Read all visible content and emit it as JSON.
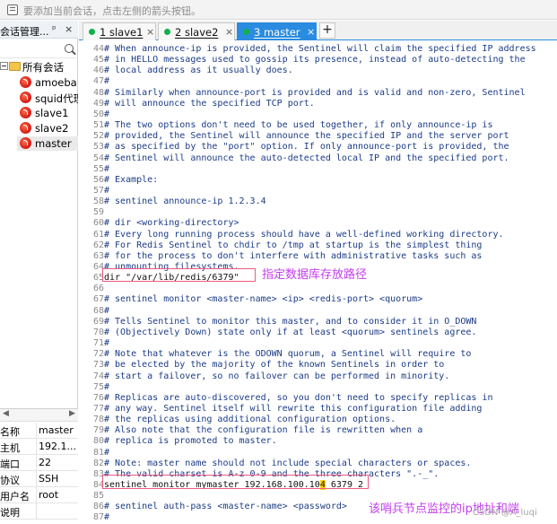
{
  "top_hint": {
    "icon": "session-list-icon",
    "text": "要添加当前会话，点击左侧的箭头按钮。"
  },
  "session_manager": {
    "title": "会话管理...",
    "pin_glyph": "ᵖ",
    "close_glyph": "×",
    "search_placeholder": "",
    "tree_root": "所有会话",
    "sessions": [
      "amoeba",
      "squid代理",
      "slave1",
      "slave2",
      "master"
    ],
    "selected_session": "master"
  },
  "properties": {
    "rows": [
      {
        "key": "名称",
        "value": "master"
      },
      {
        "key": "主机",
        "value": "192.1..."
      },
      {
        "key": "端口",
        "value": "22"
      },
      {
        "key": "协议",
        "value": "SSH"
      },
      {
        "key": "用户名",
        "value": "root"
      },
      {
        "key": "说明",
        "value": ""
      }
    ]
  },
  "tabs": [
    {
      "label": "1 slave1",
      "status_color": "#13b04b",
      "active": false
    },
    {
      "label": "2 slave2",
      "status_color": "#13b04b",
      "active": false
    },
    {
      "label": "3 master",
      "status_color": "#13b04b",
      "active": true
    }
  ],
  "add_tab": "+",
  "terminal": {
    "lines": [
      {
        "n": "44",
        "text": "# When announce-ip is provided, the Sentinel will claim the specified IP address"
      },
      {
        "n": "45",
        "text": "# in HELLO messages used to gossip its presence, instead of auto-detecting the"
      },
      {
        "n": "46",
        "text": "# local address as it usually does."
      },
      {
        "n": "47",
        "text": "#"
      },
      {
        "n": "48",
        "text": "# Similarly when announce-port is provided and is valid and non-zero, Sentinel"
      },
      {
        "n": "49",
        "text": "# will announce the specified TCP port."
      },
      {
        "n": "50",
        "text": "#"
      },
      {
        "n": "51",
        "text": "# The two options don't need to be used together, if only announce-ip is"
      },
      {
        "n": "52",
        "text": "# provided, the Sentinel will announce the specified IP and the server port"
      },
      {
        "n": "53",
        "text": "# as specified by the \"port\" option. If only announce-port is provided, the"
      },
      {
        "n": "54",
        "text": "# Sentinel will announce the auto-detected local IP and the specified port."
      },
      {
        "n": "55",
        "text": "#"
      },
      {
        "n": "56",
        "text": "# Example:"
      },
      {
        "n": "57",
        "text": "#"
      },
      {
        "n": "58",
        "text": "# sentinel announce-ip 1.2.3.4"
      },
      {
        "n": "59",
        "text": ""
      },
      {
        "n": "60",
        "text": "# dir <working-directory>"
      },
      {
        "n": "61",
        "text": "# Every long running process should have a well-defined working directory."
      },
      {
        "n": "62",
        "text": "# For Redis Sentinel to chdir to /tmp at startup is the simplest thing"
      },
      {
        "n": "63",
        "text": "# for the process to don't interfere with administrative tasks such as"
      },
      {
        "n": "64",
        "text": "# unmounting filesystems."
      },
      {
        "n": "65",
        "text": "dir \"/var/lib/redis/6379\""
      },
      {
        "n": "66",
        "text": ""
      },
      {
        "n": "67",
        "text": "# sentinel monitor <master-name> <ip> <redis-port> <quorum>"
      },
      {
        "n": "68",
        "text": "#"
      },
      {
        "n": "69",
        "text": "# Tells Sentinel to monitor this master, and to consider it in O_DOWN"
      },
      {
        "n": "70",
        "text": "# (Objectively Down) state only if at least <quorum> sentinels agree."
      },
      {
        "n": "71",
        "text": "#"
      },
      {
        "n": "72",
        "text": "# Note that whatever is the ODOWN quorum, a Sentinel will require to"
      },
      {
        "n": "73",
        "text": "# be elected by the majority of the known Sentinels in order to"
      },
      {
        "n": "74",
        "text": "# start a failover, so no failover can be performed in minority."
      },
      {
        "n": "75",
        "text": "#"
      },
      {
        "n": "76",
        "text": "# Replicas are auto-discovered, so you don't need to specify replicas in"
      },
      {
        "n": "77",
        "text": "# any way. Sentinel itself will rewrite this configuration file adding"
      },
      {
        "n": "78",
        "text": "# the replicas using additional configuration options."
      },
      {
        "n": "79",
        "text": "# Also note that the configuration file is rewritten when a"
      },
      {
        "n": "80",
        "text": "# replica is promoted to master."
      },
      {
        "n": "81",
        "text": "#"
      },
      {
        "n": "82",
        "text": "# Note: master name should not include special characters or spaces."
      },
      {
        "n": "83",
        "text": "# The valid charset is A-z 0-9 and the three characters \".-_\"."
      },
      {
        "n": "84",
        "text": "sentinel monitor mymaster 192.168.100.10",
        "cursor": "4",
        "after": " 6379 2"
      },
      {
        "n": "85",
        "text": ""
      },
      {
        "n": "86",
        "text": "# sentinel auth-pass <master-name> <password>"
      },
      {
        "n": "87",
        "text": "#"
      }
    ]
  },
  "annotations": [
    {
      "label": "指定数据库存放路径",
      "color": "#c43df0",
      "box_color": "#ee5a82"
    },
    {
      "label": "该哨兵节点监控的ip地址和端",
      "color": "#c43df0",
      "box_color": "#ee5a82"
    }
  ],
  "watermark": "CSDN @A_luqi"
}
